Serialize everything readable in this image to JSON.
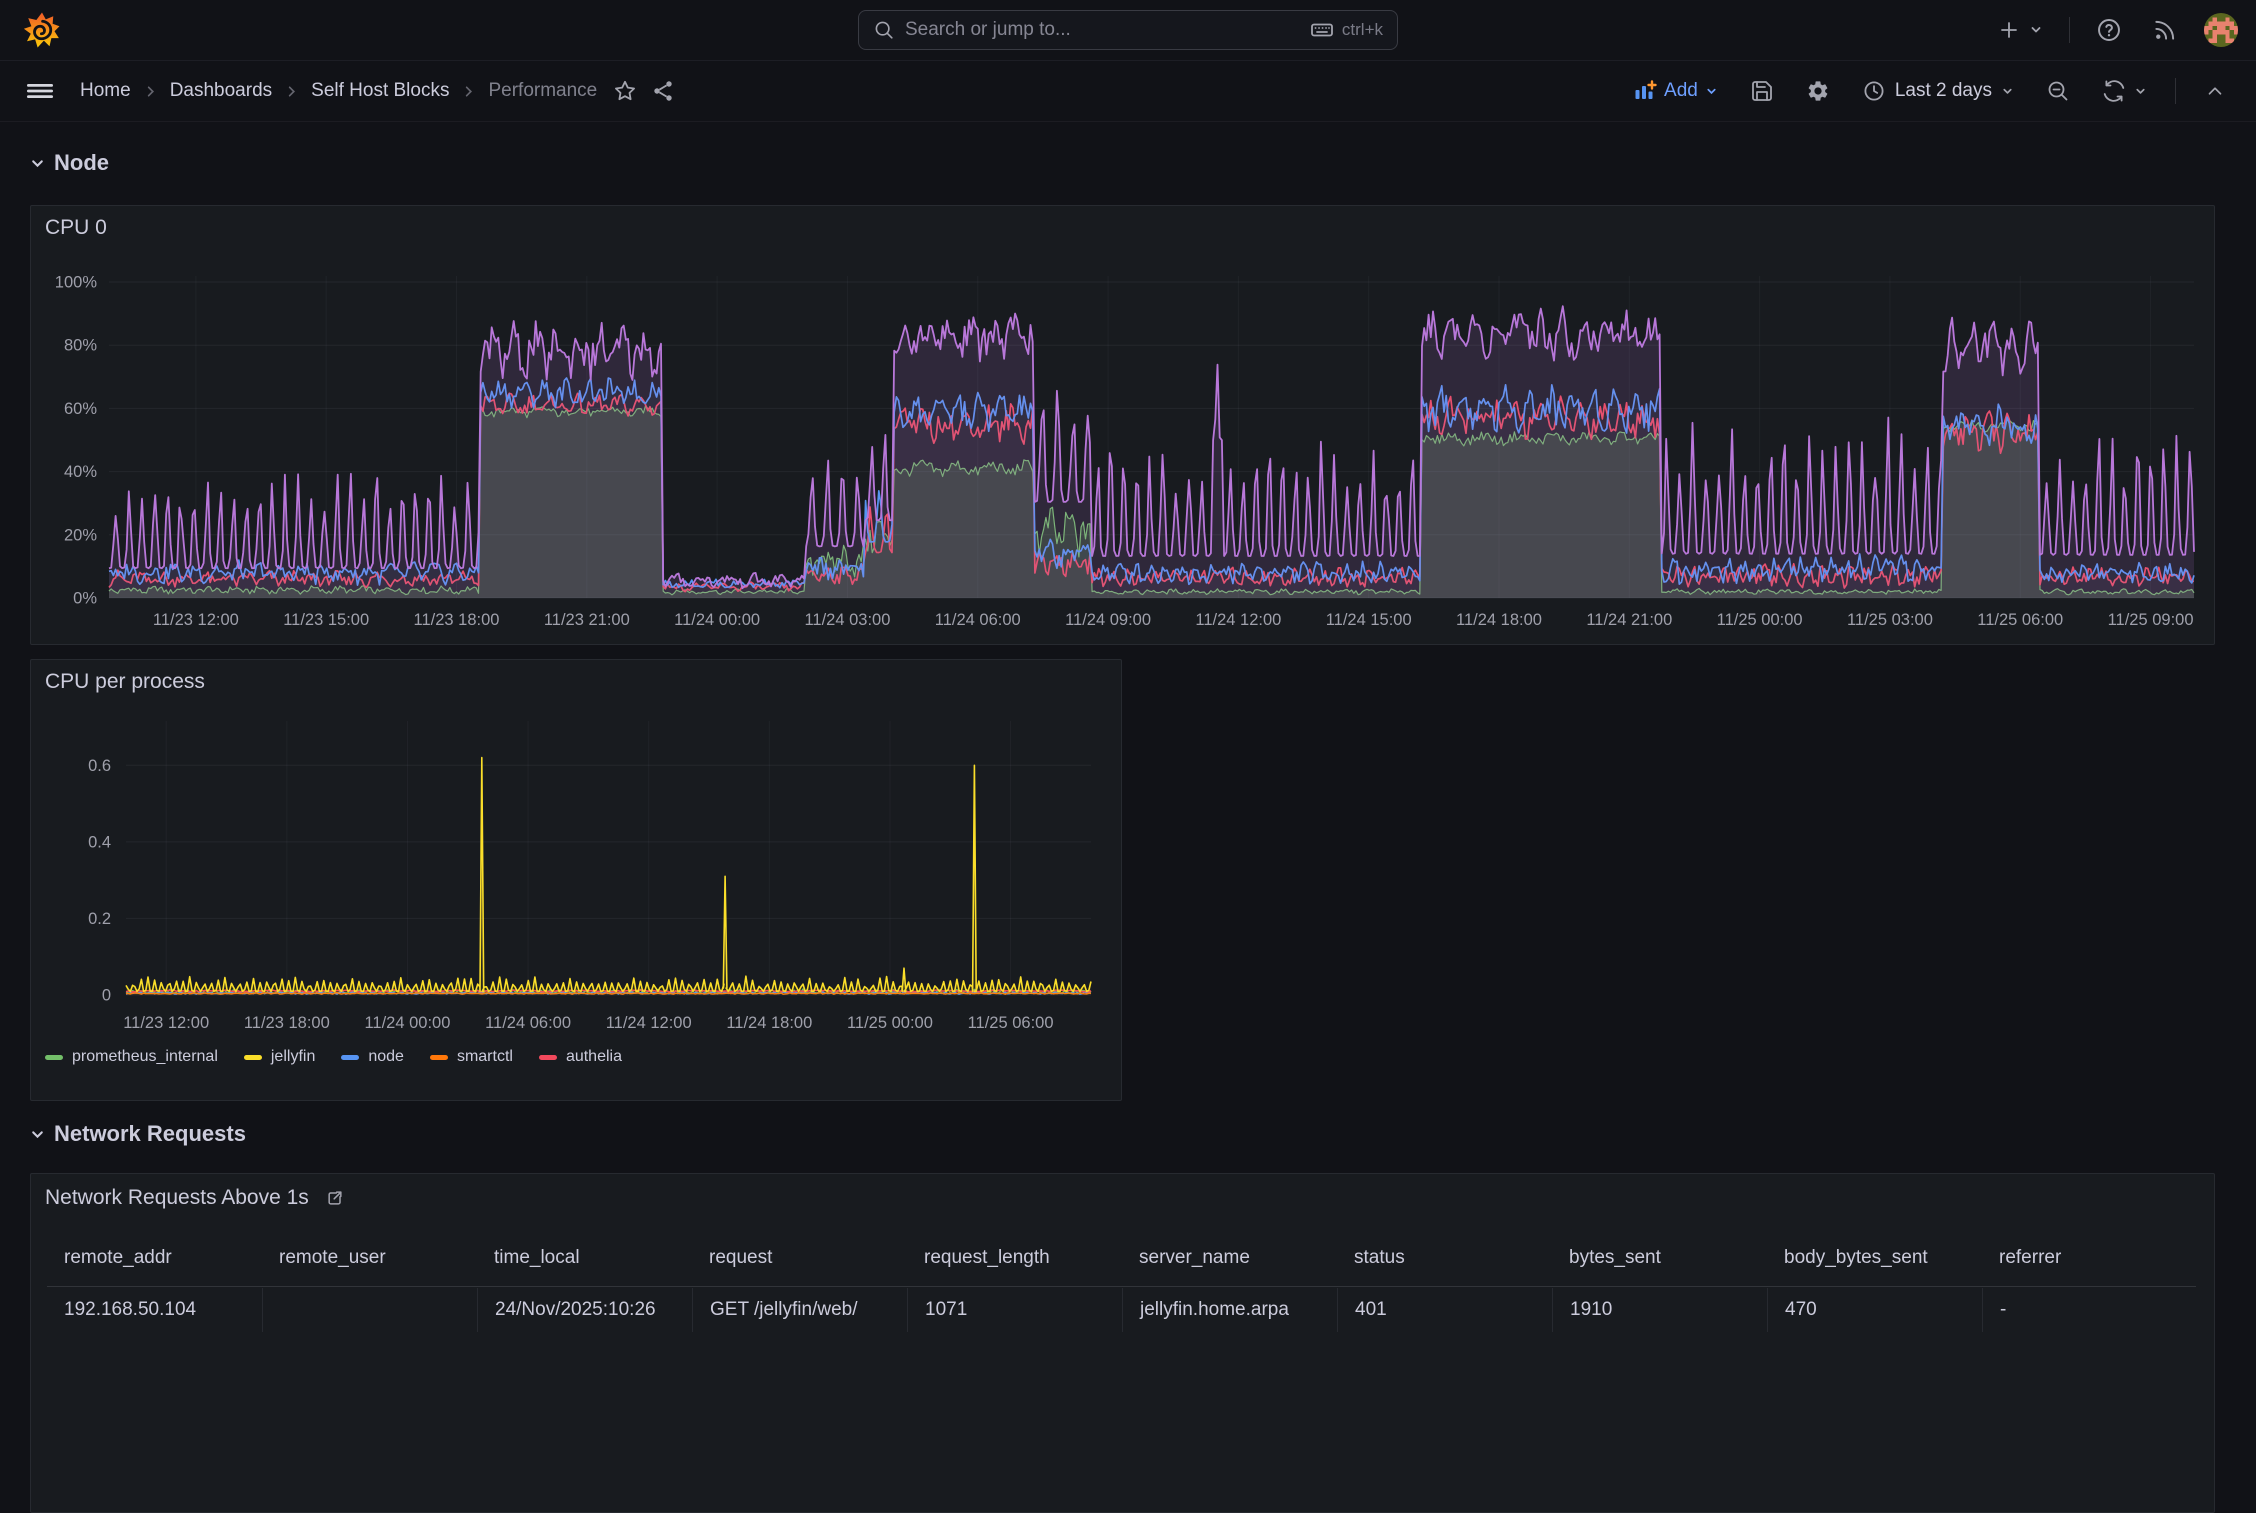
{
  "topnav": {
    "search": {
      "placeholder": "Search or jump to...",
      "shortcut": "ctrl+k"
    }
  },
  "toolbar": {
    "breadcrumb": [
      "Home",
      "Dashboards",
      "Self Host Blocks",
      "Performance"
    ],
    "add_label": "Add",
    "time_range_label": "Last 2 days"
  },
  "sections": {
    "node": "Node",
    "network": "Network Requests"
  },
  "network_table": {
    "title": "Network Requests Above 1s",
    "columns": [
      "remote_addr",
      "remote_user",
      "time_local",
      "request",
      "request_length",
      "server_name",
      "status",
      "bytes_sent",
      "body_bytes_sent",
      "referrer"
    ],
    "row_partial": [
      "192.168.50.104",
      "",
      "24/Nov/2025:10:26",
      "GET /jellyfin/web/",
      "1071",
      "jellyfin.home.arpa",
      "401",
      "1910",
      "470",
      "-"
    ]
  },
  "colors": {
    "page_bg": "#111217",
    "panel_bg": "#181b1f",
    "text": "#ccccdc",
    "text_dim": "#9fa0ab",
    "link_blue": "#6e9fff",
    "accent_orange": "#FF9830",
    "series_green": "#73BF69",
    "series_yellow": "#FADE2A",
    "series_blue": "#5794F2",
    "series_orange": "#FF780A",
    "series_red": "#F2495C",
    "series_purple": "#B877D9"
  },
  "chart_data": [
    {
      "id": "cpu0",
      "type": "area",
      "title": "CPU 0",
      "x_start": "11/23 10:00",
      "x_domain_hours": [
        0,
        48
      ],
      "x_ticks": [
        {
          "t": 2,
          "label": "11/23 12:00"
        },
        {
          "t": 5,
          "label": "11/23 15:00"
        },
        {
          "t": 8,
          "label": "11/23 18:00"
        },
        {
          "t": 11,
          "label": "11/23 21:00"
        },
        {
          "t": 14,
          "label": "11/24 00:00"
        },
        {
          "t": 17,
          "label": "11/24 03:00"
        },
        {
          "t": 20,
          "label": "11/24 06:00"
        },
        {
          "t": 23,
          "label": "11/24 09:00"
        },
        {
          "t": 26,
          "label": "11/24 12:00"
        },
        {
          "t": 29,
          "label": "11/24 15:00"
        },
        {
          "t": 32,
          "label": "11/24 18:00"
        },
        {
          "t": 35,
          "label": "11/24 21:00"
        },
        {
          "t": 38,
          "label": "11/25 00:00"
        },
        {
          "t": 41,
          "label": "11/25 03:00"
        },
        {
          "t": 44,
          "label": "11/25 06:00"
        },
        {
          "t": 47,
          "label": "11/25 09:00"
        }
      ],
      "ylim": [
        0,
        100
      ],
      "y_ticks": [
        {
          "v": 0,
          "label": "0%"
        },
        {
          "v": 20,
          "label": "20%"
        },
        {
          "v": 40,
          "label": "40%"
        },
        {
          "v": 60,
          "label": "60%"
        },
        {
          "v": 80,
          "label": "80%"
        },
        {
          "v": 100,
          "label": "100%"
        }
      ],
      "unit": "percent",
      "legend": null,
      "segment_format": [
        "t0_h",
        "t1_h",
        "low",
        "high",
        "period_h",
        "mode(0=spiky,1=band)"
      ],
      "series": [
        {
          "name": "green-area",
          "color": "#73BF69",
          "fill_opacity": 0.2,
          "stroke_width": 1.2,
          "segments": [
            [
              0,
              8.55,
              1,
              4,
              0.6,
              1
            ],
            [
              8.55,
              12.75,
              57,
              61,
              0.8,
              1
            ],
            [
              12.75,
              16.0,
              1,
              3,
              0.6,
              1
            ],
            [
              16.0,
              17.4,
              6,
              18,
              0.5,
              1
            ],
            [
              17.4,
              18.07,
              12,
              28,
              0.4,
              1
            ],
            [
              18.07,
              21.3,
              38,
              44,
              0.8,
              1
            ],
            [
              21.3,
              22.6,
              12,
              30,
              0.45,
              1
            ],
            [
              22.6,
              30.2,
              1,
              3,
              0.5,
              1
            ],
            [
              30.2,
              35.7,
              48,
              53,
              0.8,
              1
            ],
            [
              35.7,
              42.2,
              1,
              3,
              0.5,
              1
            ],
            [
              42.2,
              44.45,
              52,
              57,
              0.8,
              1
            ],
            [
              44.45,
              48,
              1,
              3,
              0.5,
              1
            ]
          ]
        },
        {
          "name": "red-line",
          "color": "#F2495C",
          "fill_opacity": 0.05,
          "stroke_width": 1.7,
          "segments": [
            [
              0,
              8.55,
              3,
              9,
              0.5,
              1
            ],
            [
              8.55,
              12.75,
              57,
              65,
              0.5,
              1
            ],
            [
              12.75,
              16.0,
              2,
              5,
              0.6,
              1
            ],
            [
              16.0,
              17.4,
              4,
              11,
              0.4,
              1
            ],
            [
              17.4,
              18.07,
              12,
              32,
              0.35,
              0
            ],
            [
              18.07,
              21.3,
              48,
              62,
              0.5,
              1
            ],
            [
              21.3,
              22.6,
              6,
              16,
              0.4,
              1
            ],
            [
              22.6,
              30.2,
              3,
              10,
              0.35,
              1
            ],
            [
              30.2,
              35.7,
              50,
              64,
              0.5,
              1
            ],
            [
              35.7,
              42.2,
              3,
              11,
              0.33,
              1
            ],
            [
              42.2,
              44.45,
              45,
              60,
              0.45,
              1
            ],
            [
              44.45,
              48,
              3,
              10,
              0.33,
              1
            ]
          ]
        },
        {
          "name": "blue-line",
          "color": "#5794F2",
          "fill_opacity": 0.05,
          "stroke_width": 1.7,
          "segments": [
            [
              0,
              8.55,
              4,
              12,
              0.5,
              1
            ],
            [
              8.55,
              12.75,
              60,
              70,
              0.5,
              1
            ],
            [
              12.75,
              16.0,
              3,
              6,
              0.6,
              1
            ],
            [
              16.0,
              17.4,
              5,
              14,
              0.4,
              1
            ],
            [
              17.4,
              18.07,
              15,
              38,
              0.35,
              0
            ],
            [
              18.07,
              21.3,
              52,
              66,
              0.5,
              1
            ],
            [
              21.3,
              22.6,
              8,
              20,
              0.4,
              1
            ],
            [
              22.6,
              30.2,
              4,
              12,
              0.35,
              1
            ],
            [
              30.2,
              35.7,
              52,
              68,
              0.5,
              1
            ],
            [
              35.7,
              42.2,
              4,
              14,
              0.33,
              1
            ],
            [
              42.2,
              44.45,
              48,
              62,
              0.45,
              1
            ],
            [
              44.45,
              48,
              4,
              12,
              0.33,
              1
            ]
          ]
        },
        {
          "name": "purple-line",
          "color": "#B877D9",
          "fill_opacity": 0.15,
          "stroke_width": 1.8,
          "segments": [
            [
              0,
              8.55,
              5,
              42,
              0.3,
              0
            ],
            [
              8.55,
              12.75,
              68,
              88,
              0.5,
              1
            ],
            [
              12.75,
              16.0,
              3,
              8,
              0.6,
              1
            ],
            [
              16.0,
              17.4,
              12,
              48,
              0.35,
              0
            ],
            [
              17.4,
              18.07,
              20,
              58,
              0.3,
              0
            ],
            [
              18.07,
              21.3,
              74,
              91,
              0.5,
              1
            ],
            [
              21.3,
              22.6,
              25,
              70,
              0.35,
              0
            ],
            [
              22.6,
              25.4,
              8,
              52,
              0.3,
              0
            ],
            [
              25.4,
              25.65,
              45,
              86,
              0.2,
              0
            ],
            [
              25.65,
              30.2,
              8,
              52,
              0.3,
              0
            ],
            [
              30.2,
              35.7,
              74,
              93,
              0.5,
              1
            ],
            [
              35.7,
              42.2,
              8,
              58,
              0.3,
              0
            ],
            [
              42.2,
              44.45,
              70,
              90,
              0.45,
              1
            ],
            [
              44.45,
              48,
              8,
              55,
              0.3,
              0
            ]
          ]
        }
      ]
    },
    {
      "id": "cpuproc",
      "type": "line",
      "title": "CPU per process",
      "x_start": "11/23 10:00",
      "x_domain_hours": [
        0,
        48
      ],
      "x_ticks": [
        {
          "t": 2,
          "label": "11/23 12:00"
        },
        {
          "t": 8,
          "label": "11/23 18:00"
        },
        {
          "t": 14,
          "label": "11/24 00:00"
        },
        {
          "t": 20,
          "label": "11/24 06:00"
        },
        {
          "t": 26,
          "label": "11/24 12:00"
        },
        {
          "t": 32,
          "label": "11/24 18:00"
        },
        {
          "t": 38,
          "label": "11/25 00:00"
        },
        {
          "t": 44,
          "label": "11/25 06:00"
        }
      ],
      "ylim": [
        0,
        0.7
      ],
      "y_ticks": [
        {
          "v": 0,
          "label": "0"
        },
        {
          "v": 0.2,
          "label": "0.2"
        },
        {
          "v": 0.4,
          "label": "0.4"
        },
        {
          "v": 0.6,
          "label": "0.6"
        }
      ],
      "legend": [
        {
          "label": "prometheus_internal",
          "color": "#73BF69"
        },
        {
          "label": "jellyfin",
          "color": "#FADE2A"
        },
        {
          "label": "node",
          "color": "#5794F2"
        },
        {
          "label": "smartctl",
          "color": "#FF780A"
        },
        {
          "label": "authelia",
          "color": "#F2495C"
        }
      ],
      "segment_format": [
        "t0_h",
        "t1_h",
        "low",
        "high",
        "period_h",
        "mode(0=spiky,1=band)"
      ],
      "series": [
        {
          "name": "prometheus_internal",
          "color": "#73BF69",
          "fill_opacity": 0,
          "stroke_width": 1.4,
          "segments": [
            [
              0,
              48,
              0.004,
              0.016,
              0.45,
              0
            ]
          ]
        },
        {
          "name": "node",
          "color": "#5794F2",
          "fill_opacity": 0,
          "stroke_width": 1.4,
          "segments": [
            [
              0,
              48,
              0.002,
              0.008,
              0.5,
              1
            ]
          ]
        },
        {
          "name": "smartctl",
          "color": "#FF780A",
          "fill_opacity": 0,
          "stroke_width": 1.4,
          "segments": [
            [
              0,
              48,
              0.002,
              0.006,
              0.5,
              1
            ]
          ]
        },
        {
          "name": "authelia",
          "color": "#F2495C",
          "fill_opacity": 0,
          "stroke_width": 1.6,
          "segments": [
            [
              0,
              48,
              0.008,
              0.013,
              3,
              1
            ]
          ]
        },
        {
          "name": "jellyfin",
          "color": "#FADE2A",
          "fill_opacity": 0.07,
          "stroke_width": 1.6,
          "segments": [
            [
              0,
              48,
              0.004,
              0.05,
              0.35,
              0
            ]
          ],
          "spikes": [
            [
              17.7,
              0.62
            ],
            [
              29.8,
              0.31
            ],
            [
              38.7,
              0.07
            ],
            [
              42.2,
              0.6
            ]
          ]
        }
      ]
    }
  ]
}
